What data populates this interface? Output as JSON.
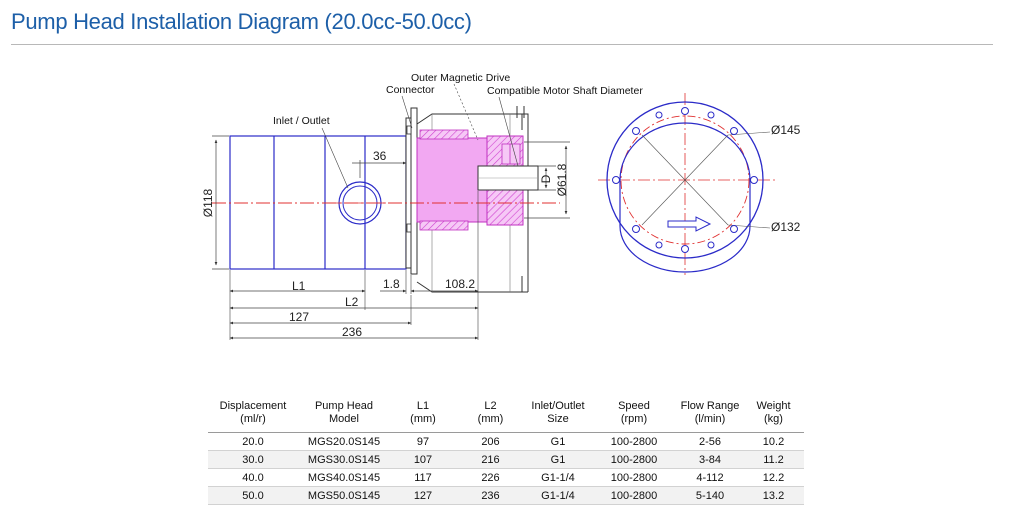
{
  "page": {
    "title": "Pump Head Installation Diagram (20.0cc-50.0cc)"
  },
  "drawing": {
    "labels": {
      "outer_magnetic_drive": "Outer Magnetic Drive",
      "connector": "Connector",
      "compatible_motor_shaft": "Compatible Motor Shaft Diameter",
      "inlet_outlet": "Inlet / Outlet"
    },
    "dimensions": {
      "d118": "Ø118",
      "d36": "36",
      "d61_8": "Ø61.8",
      "D": "D",
      "d1_8": "1.8",
      "d108_2": "108.2",
      "L1": "L1",
      "L2": "L2",
      "d127": "127",
      "d236": "236",
      "d145": "Ø145",
      "d132": "Ø132"
    }
  },
  "table": {
    "headers": [
      [
        "Displacement",
        "(ml/r)"
      ],
      [
        "Pump Head",
        "Model"
      ],
      [
        "L1",
        "(mm)"
      ],
      [
        "L2",
        "(mm)"
      ],
      [
        "Inlet/Outlet",
        "Size"
      ],
      [
        "Speed",
        "(rpm)"
      ],
      [
        "Flow Range",
        "(l/min)"
      ],
      [
        "Weight",
        "(kg)"
      ]
    ],
    "rows": [
      [
        "20.0",
        "MGS20.0S145",
        "97",
        "206",
        "G1",
        "100-2800",
        "2-56",
        "10.2"
      ],
      [
        "30.0",
        "MGS30.0S145",
        "107",
        "216",
        "G1",
        "100-2800",
        "3-84",
        "11.2"
      ],
      [
        "40.0",
        "MGS40.0S145",
        "117",
        "226",
        "G1-1/4",
        "100-2800",
        "4-112",
        "12.2"
      ],
      [
        "50.0",
        "MGS50.0S145",
        "127",
        "236",
        "G1-1/4",
        "100-2800",
        "5-140",
        "13.2"
      ]
    ]
  },
  "colors": {
    "title": "#1d5fa8",
    "outline_blue": "#2b2bc8",
    "center_red": "#e03030",
    "magenta_fill": "#e060e0"
  }
}
